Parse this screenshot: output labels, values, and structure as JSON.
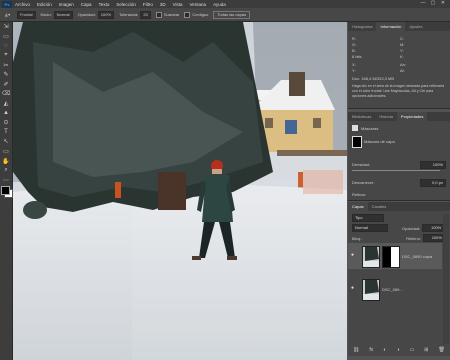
{
  "menu": {
    "logo": "Ps",
    "items": [
      "Archivo",
      "Edición",
      "Imagen",
      "Capa",
      "Texto",
      "Selección",
      "Filtro",
      "3D",
      "Vista",
      "Ventana",
      "Ayuda"
    ]
  },
  "window_controls": [
    "—",
    "▢",
    "✕"
  ],
  "options_bar": {
    "mode_label": "Modo:",
    "mode_value": "Normal",
    "opacity_label": "Opacidad:",
    "opacity_value": "100%",
    "flow_label": "Tolerancia:",
    "flow_value": "20",
    "smooth_label": "Suavizar",
    "contiguous_label": "Contiguo",
    "all_layers_label": "Todas las capas",
    "preset_value": "Frontal"
  },
  "tools": [
    "⇲",
    "▭",
    "◌",
    "⌖",
    "✂",
    "✎",
    "✐",
    "⌫",
    "◭",
    "▲",
    "⊙",
    "T",
    "↖",
    "▭",
    "✋",
    "⌕",
    "⋯"
  ],
  "histogram_panel": {
    "tabs": [
      "Histograma",
      "Información",
      "Ajustes"
    ],
    "active_tab": "Información",
    "r_label": "R:",
    "g_label": "G:",
    "b_label": "B:",
    "c_label": "C:",
    "m_label": "M:",
    "y_label": "Y:",
    "k_label": "K:",
    "bit_label": "8 bits",
    "x_label": "X:",
    "y2_label": "Y:",
    "w_label": "An:",
    "h_label": "Al:",
    "doc_label": "Doc: 168,4 M/333,3 MB",
    "hint": "Haga clic en el área de la imagen deseada para rellenarla con el color frontal. Use Mayúsculas, Alt y Ctrl para opciones adicionales."
  },
  "properties_panel": {
    "tabs": [
      "Bibliotecas",
      "Historia",
      "Propiedades"
    ],
    "active_tab": "Propiedades",
    "type_label": "Máscaras",
    "mask_label": "Máscara de capa",
    "density_label": "Densidad:",
    "density_value": "100%",
    "feather_label": "Desvanecer:",
    "feather_value": "0,0 px",
    "refine_label": "Refinar:"
  },
  "layers_panel": {
    "tabs": [
      "Capas",
      "Canales"
    ],
    "active_tab": "Capas",
    "filter_label": "Tipo",
    "blend_mode": "Normal",
    "opacity_label": "Opacidad:",
    "opacity_value": "100%",
    "lock_label": "Bloq.:",
    "fill_label": "Relleno:",
    "fill_value": "100%",
    "layers": [
      {
        "name": "DSC_0890 copia"
      },
      {
        "name": "DSC_089..."
      }
    ]
  },
  "bottom_icons": [
    "⛓",
    "fx",
    "◐",
    "◑",
    "▭",
    "⊞",
    "🗑"
  ],
  "colors": {
    "ui_dark": "#3c3c3c",
    "ui_mid": "#474747",
    "snow": "#dfe3e8",
    "jacket": "#2d4641",
    "hat": "#b5301f"
  }
}
